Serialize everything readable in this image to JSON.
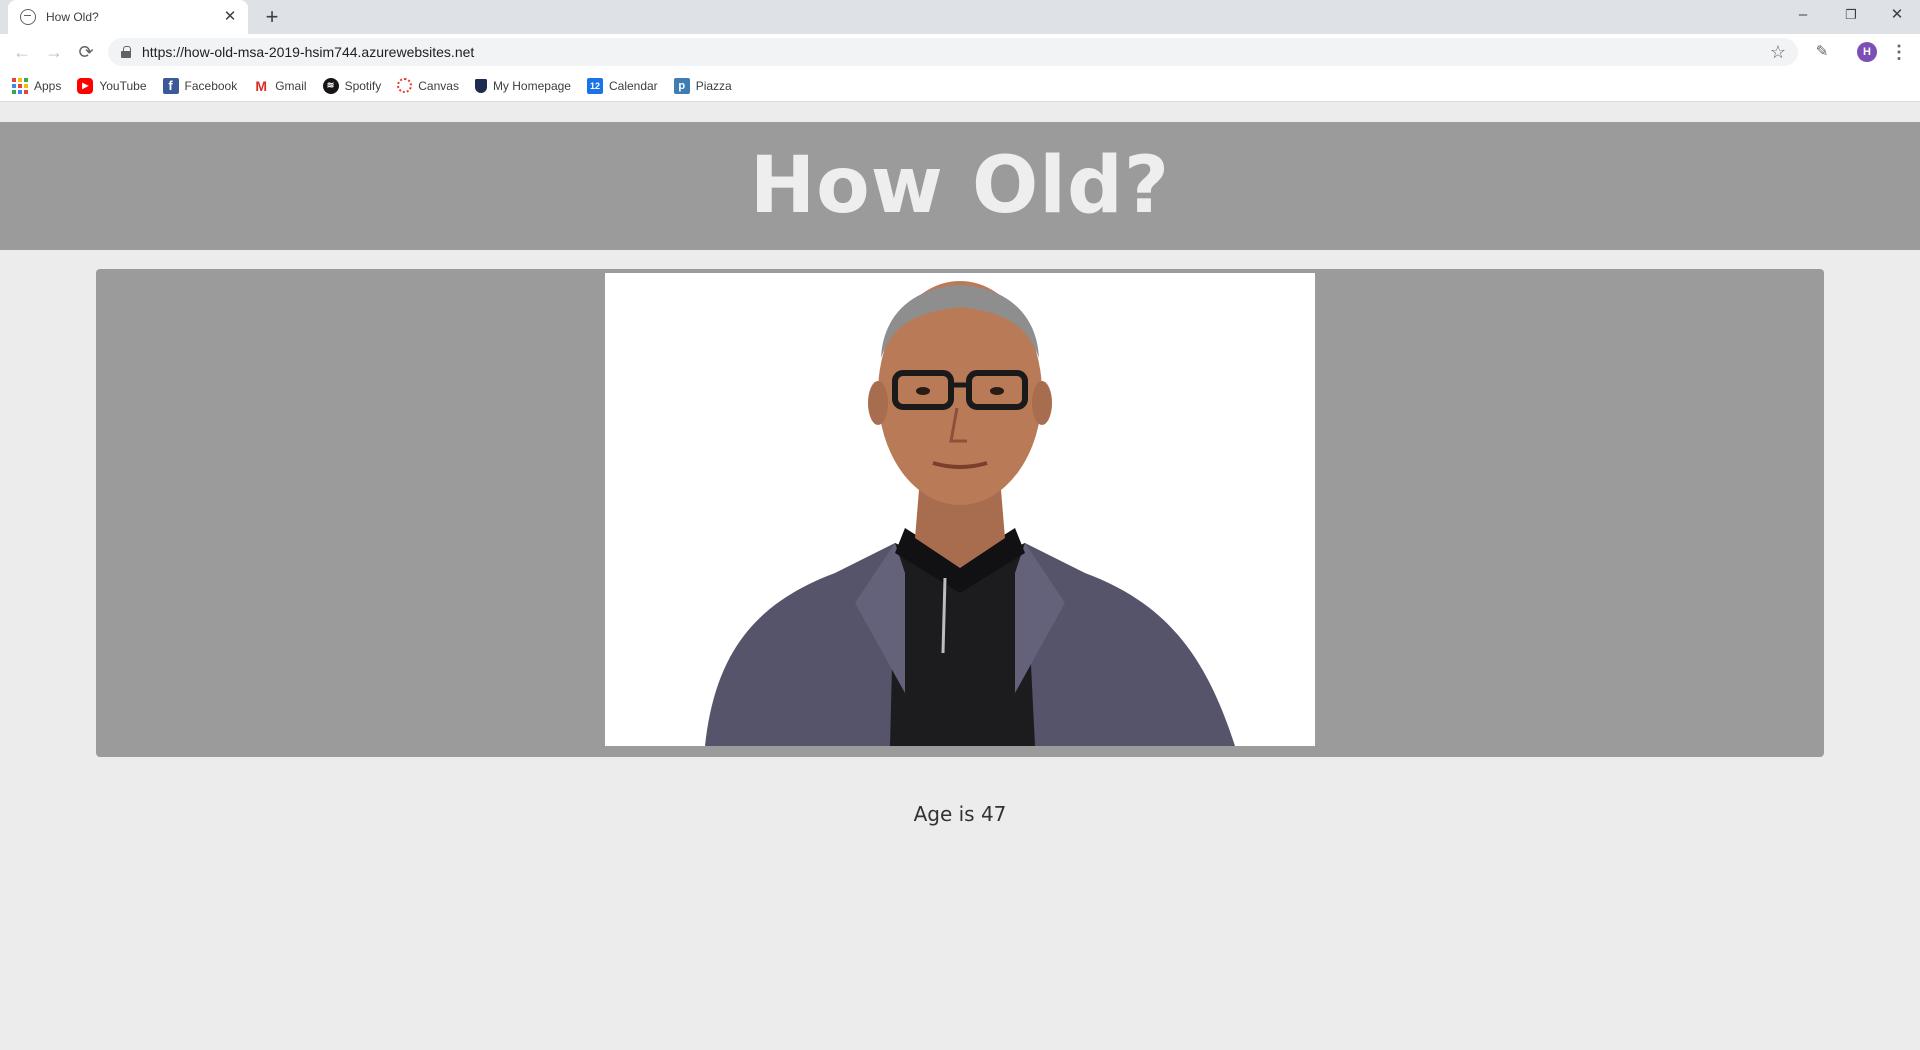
{
  "browser": {
    "tab_title": "How Old?",
    "tab_close": "✕",
    "new_tab": "+",
    "window_controls": {
      "minimize": "–",
      "restore": "❐",
      "close": "✕"
    },
    "url": "https://how-old-msa-2019-hsim744.azurewebsites.net",
    "icons": {
      "back": "back-arrow-icon",
      "forward": "forward-arrow-icon",
      "reload": "reload-icon",
      "lock": "lock-icon",
      "star": "star-icon",
      "eyedropper": "eyedropper-icon",
      "menu": "more-vert-icon"
    },
    "profile_initial": "H",
    "profile_color": "#7b4fb5"
  },
  "bookmarks": [
    {
      "label": "Apps",
      "icon": "apps-grid-icon"
    },
    {
      "label": "YouTube",
      "icon": "youtube-icon",
      "glyph": "▶"
    },
    {
      "label": "Facebook",
      "icon": "facebook-icon",
      "glyph": "f"
    },
    {
      "label": "Gmail",
      "icon": "gmail-icon",
      "glyph": "M"
    },
    {
      "label": "Spotify",
      "icon": "spotify-icon",
      "glyph": "≋"
    },
    {
      "label": "Canvas",
      "icon": "canvas-icon"
    },
    {
      "label": "My Homepage",
      "icon": "shield-icon"
    },
    {
      "label": "Calendar",
      "icon": "calendar-icon",
      "glyph": "12"
    },
    {
      "label": "Piazza",
      "icon": "piazza-icon",
      "glyph": "p"
    }
  ],
  "page": {
    "title": "How Old?",
    "result": "Age is 47",
    "colors": {
      "header_band": "#9b9b9b",
      "title_text": "#eeeeee",
      "background": "#ececec",
      "panel": "#9b9b9b"
    }
  }
}
